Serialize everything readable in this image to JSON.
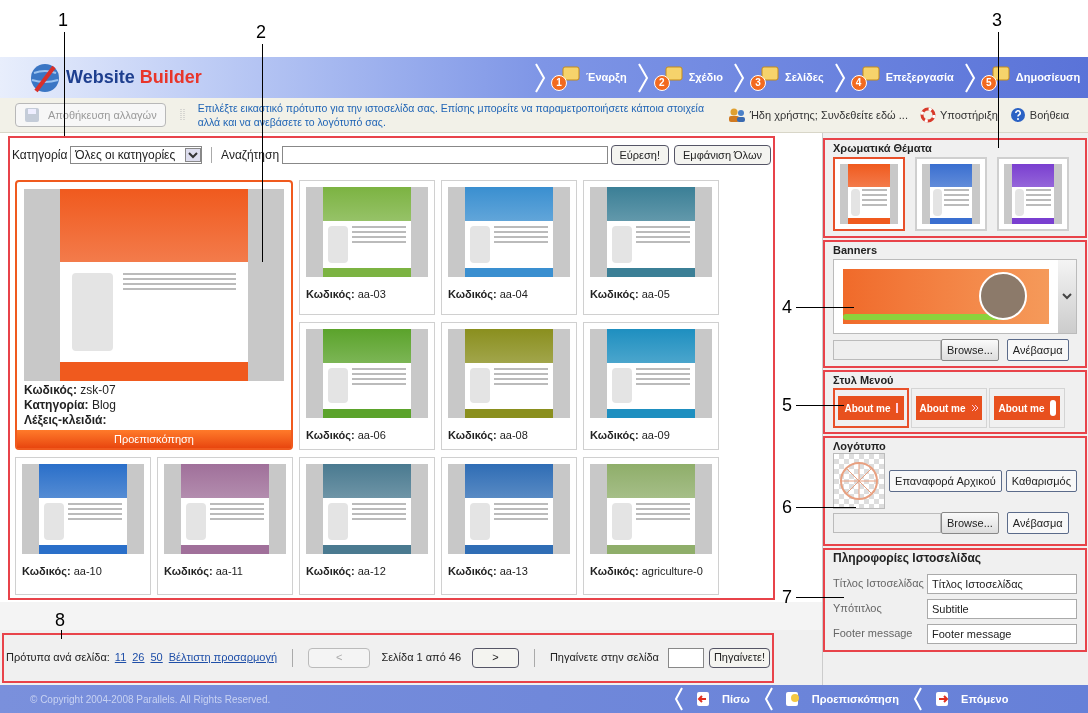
{
  "logo": {
    "brand": "Website",
    "product": "Builder"
  },
  "steps": [
    {
      "number": "1",
      "label": "Έναρξη"
    },
    {
      "number": "2",
      "label": "Σχέδιο"
    },
    {
      "number": "3",
      "label": "Σελίδες"
    },
    {
      "number": "4",
      "label": "Επεξεργασία"
    },
    {
      "number": "5",
      "label": "Δημοσίευση"
    }
  ],
  "toolbar": {
    "save_button": {
      "label": "Αποθήκευση αλλαγών",
      "disabled": true
    },
    "hint": "Επιλέξτε εικαστικό πρότυπο για την ιστοσελίδα σας. Επίσης μπορείτε να παραμετροποιήσετε κάποια στοιχεία αλλά και να ανεβάσετε το λογότυπό σας.",
    "links": [
      {
        "kind": "login",
        "label": "Ήδη χρήστης; Συνδεθείτε εδώ ..."
      },
      {
        "kind": "support",
        "label": "Υποστήριξη"
      },
      {
        "kind": "help",
        "label": "Βοήθεια"
      }
    ]
  },
  "filter": {
    "category_label": "Κατηγορία",
    "category_value": "Όλες οι κατηγορίες",
    "search_label": "Αναζήτηση",
    "search_button": "Εύρεση!",
    "show_all_button": "Εμφάνιση Όλων"
  },
  "templates": [
    {
      "kind": "featured",
      "selected": true,
      "color": "#f05a1e",
      "code_label": "Κωδικός:",
      "code": "zsk-07",
      "category_label": "Κατηγορία:",
      "category": "Blog",
      "keywords_label": "Λέξεις-κλειδιά:",
      "preview_button": "Προεπισκόπηση"
    },
    {
      "kind": "card",
      "selected": false,
      "color": "#7cb342",
      "code_label": "Κωδικός:",
      "code": "aa-03"
    },
    {
      "kind": "card",
      "selected": false,
      "color": "#3a8fd0",
      "code_label": "Κωδικός:",
      "code": "aa-04"
    },
    {
      "kind": "card",
      "selected": false,
      "color": "#3b7f96",
      "code_label": "Κωδικός:",
      "code": "aa-05"
    },
    {
      "kind": "card",
      "selected": false,
      "color": "#5ba32b",
      "code_label": "Κωδικός:",
      "code": "aa-06"
    },
    {
      "kind": "card",
      "selected": false,
      "color": "#8a8f1e",
      "code_label": "Κωδικός:",
      "code": "aa-08"
    },
    {
      "kind": "card",
      "selected": false,
      "color": "#1e8fc0",
      "code_label": "Κωδικός:",
      "code": "aa-09"
    },
    {
      "kind": "card",
      "selected": false,
      "color": "#2a6fc9",
      "code_label": "Κωδικός:",
      "code": "aa-10"
    },
    {
      "kind": "card",
      "selected": false,
      "color": "#a0709a",
      "code_label": "Κωδικός:",
      "code": "aa-11"
    },
    {
      "kind": "card",
      "selected": false,
      "color": "#4a7a90",
      "code_label": "Κωδικός:",
      "code": "aa-12"
    },
    {
      "kind": "card",
      "selected": false,
      "color": "#2f6db5",
      "code_label": "Κωδικός:",
      "code": "aa-13"
    },
    {
      "kind": "card",
      "selected": false,
      "color": "#8fae6a",
      "code_label": "Κωδικός:",
      "code": "agriculture-0"
    }
  ],
  "themes": {
    "title": "Χρωματικά Θέματα",
    "items": [
      {
        "color": "#f05a1e",
        "selected": true
      },
      {
        "color": "#3a6fd0",
        "selected": false
      },
      {
        "color": "#7a3fd0",
        "selected": false
      }
    ]
  },
  "banners": {
    "title": "Banners",
    "browse_button": "Browse...",
    "upload_button": "Ανέβασμα"
  },
  "menu_styles": {
    "title": "Στυλ Μενού",
    "items": [
      {
        "label": "About me",
        "kind": "bar",
        "selected": true
      },
      {
        "label": "About me",
        "kind": "arrows",
        "selected": false
      },
      {
        "label": "About me",
        "kind": "pill",
        "selected": false
      }
    ]
  },
  "logo_section": {
    "title": "Λογότυπο",
    "reset_button": "Επαναφορά Αρχικού",
    "clear_button": "Καθαρισμός",
    "browse_button": "Browse...",
    "upload_button": "Ανέβασμα"
  },
  "site_info": {
    "title": "Πληροφορίες Ιστοσελίδας",
    "fields": [
      {
        "label": "Τίτλος Ιστοσελίδας",
        "value": "Τίτλος Ιστοσελίδας"
      },
      {
        "label": "Υπότιτλος",
        "value": "Subtitle"
      },
      {
        "label": "Footer message",
        "value": "Footer message"
      }
    ]
  },
  "pager": {
    "per_page_label": "Πρότυπα ανά σελίδα:",
    "per_page_options": [
      "11",
      "26",
      "50",
      "Βέλτιστη προσαρμογή"
    ],
    "prev_button": {
      "label": "<",
      "disabled": true
    },
    "page_text": "Σελίδα 1 από 46",
    "next_button": {
      "label": ">",
      "disabled": false
    },
    "goto_label": "Πηγαίνετε στην σελίδα",
    "goto_button": "Πηγαίνετε!"
  },
  "footer": {
    "copyright": "© Copyright 2004-2008 Parallels. All Rights Reserved.",
    "nav": [
      {
        "kind": "back",
        "label": "Πίσω"
      },
      {
        "kind": "preview",
        "label": "Προεπισκόπηση"
      },
      {
        "kind": "next",
        "label": "Επόμενο"
      }
    ]
  },
  "callouts": [
    "1",
    "2",
    "3",
    "4",
    "5",
    "6",
    "7",
    "8"
  ]
}
